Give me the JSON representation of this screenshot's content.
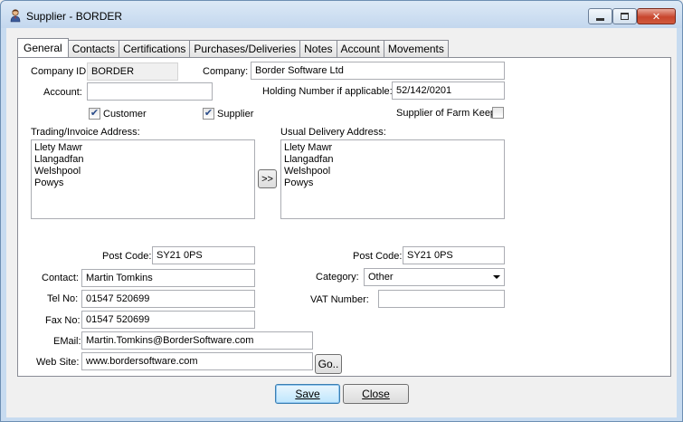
{
  "window": {
    "title": "Supplier - BORDER"
  },
  "tabs": [
    {
      "label": "General"
    },
    {
      "label": "Contacts"
    },
    {
      "label": "Certifications"
    },
    {
      "label": "Purchases/Deliveries"
    },
    {
      "label": "Notes"
    },
    {
      "label": "Account"
    },
    {
      "label": "Movements"
    }
  ],
  "general": {
    "company_id_label": "Company ID:",
    "company_id": "BORDER",
    "company_label": "Company:",
    "company": "Border Software Ltd",
    "account_label": "Account:",
    "account": "",
    "holding_label": "Holding Number if applicable:",
    "holding": "52/142/0201",
    "customer_label": "Customer",
    "customer_checked": true,
    "supplier_label": "Supplier",
    "supplier_checked": true,
    "farm_keep_label": "Supplier of Farm Keep",
    "farm_keep_checked": false,
    "trading_label": "Trading/Invoice Address:",
    "trading_lines": [
      "Llety Mawr",
      "Llangadfan",
      "Welshpool",
      "Powys"
    ],
    "delivery_label": "Usual Delivery Address:",
    "delivery_lines": [
      "Llety Mawr",
      "Llangadfan",
      "Welshpool",
      "Powys"
    ],
    "copy_label": ">>",
    "postcode_label": "Post Code:",
    "postcode": "SY21 0PS",
    "delivery_postcode": "SY21 0PS",
    "contact_label": "Contact:",
    "contact": "Martin Tomkins",
    "category_label": "Category:",
    "category": "Other",
    "tel_label": "Tel No:",
    "tel": "01547 520699",
    "vat_label": "VAT Number:",
    "vat": "",
    "fax_label": "Fax No:",
    "fax": "01547 520699",
    "email_label": "EMail:",
    "email": "Martin.Tomkins@BorderSoftware.com",
    "website_label": "Web Site:",
    "website": "www.bordersoftware.com",
    "go_label": "Go.."
  },
  "footer": {
    "save_label": "Save",
    "close_label": "Close"
  }
}
